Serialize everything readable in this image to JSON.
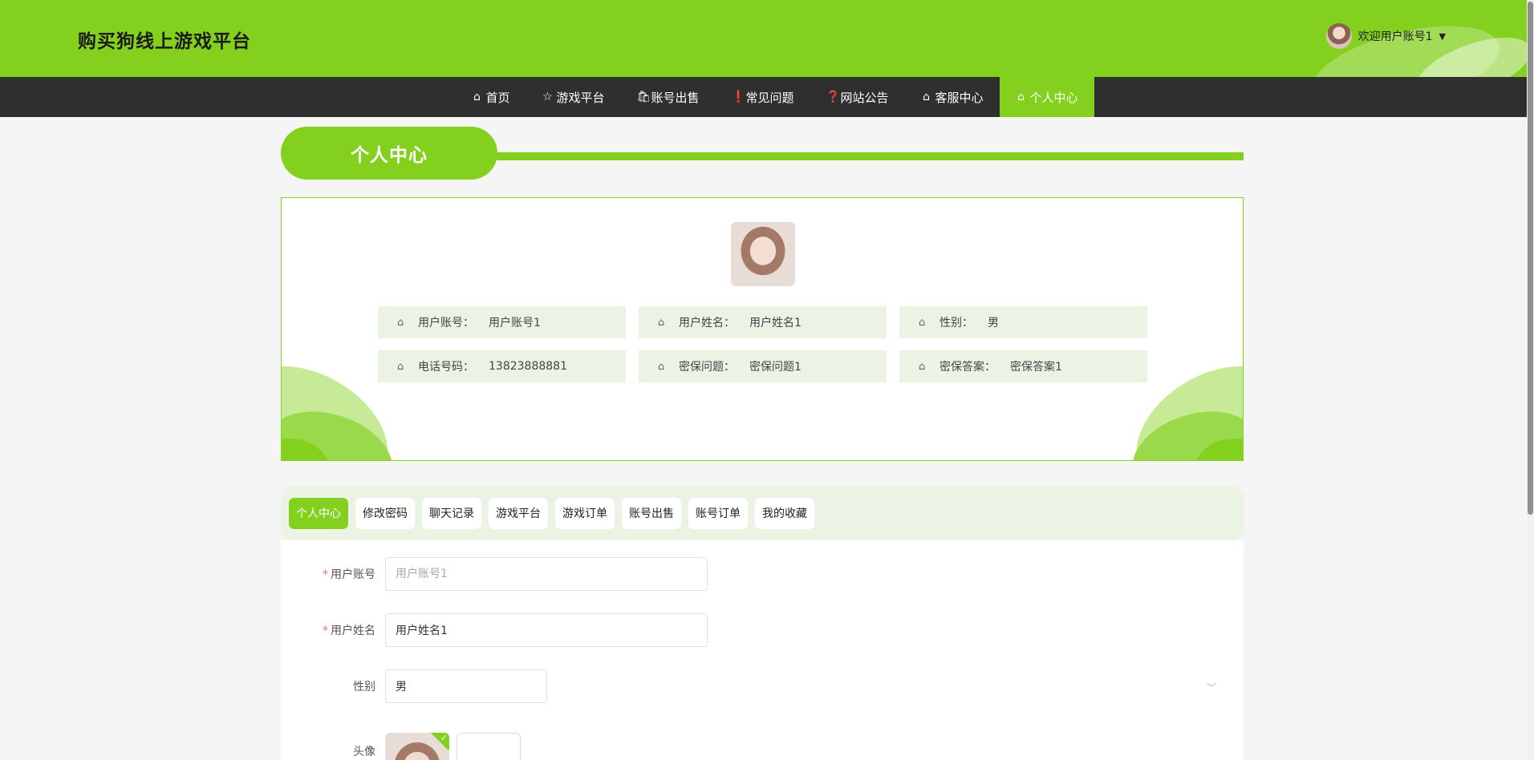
{
  "header": {
    "site_title": "购买狗线上游戏平台",
    "welcome_text": "欢迎用户账号1",
    "caret": "▼"
  },
  "nav": {
    "items": [
      {
        "label": "首页",
        "icon": "⌂"
      },
      {
        "label": "游戏平台",
        "icon": "☆"
      },
      {
        "label": "账号出售",
        "icon": "🛍"
      },
      {
        "label": "常见问题",
        "icon": "❗"
      },
      {
        "label": "网站公告",
        "icon": "❓"
      },
      {
        "label": "客服中心",
        "icon": "⌂"
      },
      {
        "label": "个人中心",
        "icon": "⌂"
      }
    ],
    "active": "个人中心"
  },
  "section": {
    "title": "个人中心"
  },
  "profile": {
    "fields": [
      {
        "label": "用户账号：",
        "value": "用户账号1"
      },
      {
        "label": "用户姓名：",
        "value": "用户姓名1"
      },
      {
        "label": "性别：",
        "value": "男"
      },
      {
        "label": "电话号码：",
        "value": "13823888881"
      },
      {
        "label": "密保问题：",
        "value": "密保问题1"
      },
      {
        "label": "密保答案：",
        "value": "密保答案1"
      }
    ],
    "field_icon": "⌂"
  },
  "tabs": {
    "items": [
      "个人中心",
      "修改密码",
      "聊天记录",
      "游戏平台",
      "游戏订单",
      "账号出售",
      "账号订单",
      "我的收藏"
    ],
    "active": "个人中心"
  },
  "form": {
    "required_mark": "*",
    "account": {
      "label": "用户账号",
      "placeholder": "用户账号1"
    },
    "name": {
      "label": "用户姓名",
      "value": "用户姓名1"
    },
    "gender": {
      "label": "性别",
      "value": "男",
      "arrow": "﹀"
    },
    "avatar": {
      "label": "头像",
      "upload_plus": "+",
      "check": "✓"
    }
  },
  "colors": {
    "brand_green": "#83d01f",
    "nav_dark": "#2f2f2f",
    "light_green": "#eaf3e4"
  }
}
